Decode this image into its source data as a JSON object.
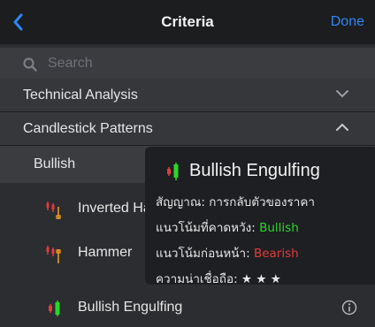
{
  "header": {
    "title": "Criteria",
    "done_label": "Done"
  },
  "search": {
    "placeholder": "Search"
  },
  "sections": [
    {
      "label": "Technical Analysis",
      "expanded": false
    },
    {
      "label": "Candlestick Patterns",
      "expanded": true
    }
  ],
  "subsection": {
    "label": "Bullish"
  },
  "items": [
    {
      "label": "Inverted Hammer",
      "icon": "inverted-hammer-candle-icon"
    },
    {
      "label": "Hammer",
      "icon": "hammer-candle-icon"
    },
    {
      "label": "Bullish Engulfing",
      "icon": "bullish-engulfing-candle-icon"
    }
  ],
  "tooltip": {
    "title": "Bullish Engulfing",
    "signal_label": "สัญญาณ:",
    "signal_value": "การกลับตัวของราคา",
    "expected_label": "แนวโน้มที่คาดหวัง:",
    "expected_value": "Bullish",
    "prior_label": "แนวโน้มก่อนหน้า:",
    "prior_value": "Bearish",
    "reliability_label": "ความน่าเชื่อถือ:",
    "reliability_stars": "★ ★ ★"
  },
  "colors": {
    "accent": "#2f86f6",
    "bullish": "#2bd62b",
    "bearish": "#e23b3b"
  }
}
